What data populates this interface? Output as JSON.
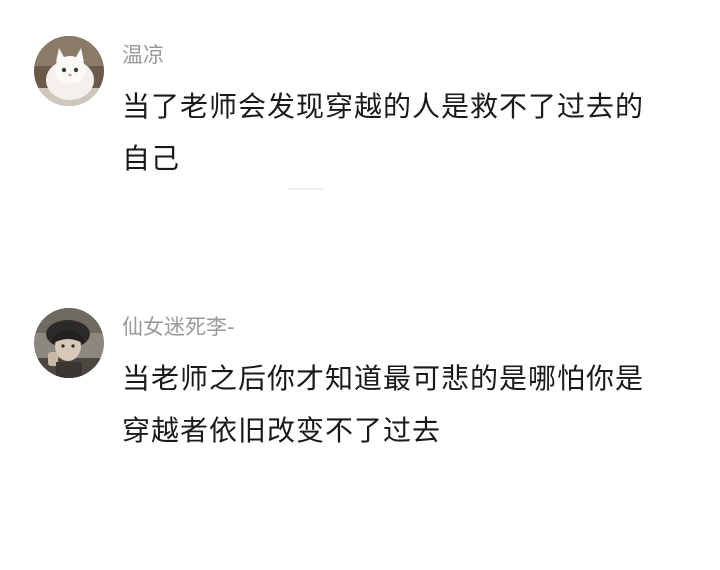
{
  "comments": [
    {
      "username": "温凉",
      "avatar_icon": "white-cat-avatar",
      "lines": [
        "当了老师会发现穿越的人是救不了过去的",
        "自己"
      ]
    },
    {
      "username": "仙女迷死李-",
      "avatar_icon": "girl-portrait-avatar",
      "lines": [
        "当老师之后你才知道最可悲的是哪怕你是",
        "穿越者依旧改变不了过去"
      ]
    }
  ],
  "colors": {
    "username": "#9a9a9a",
    "text": "#1a1a1a",
    "background": "#ffffff"
  }
}
